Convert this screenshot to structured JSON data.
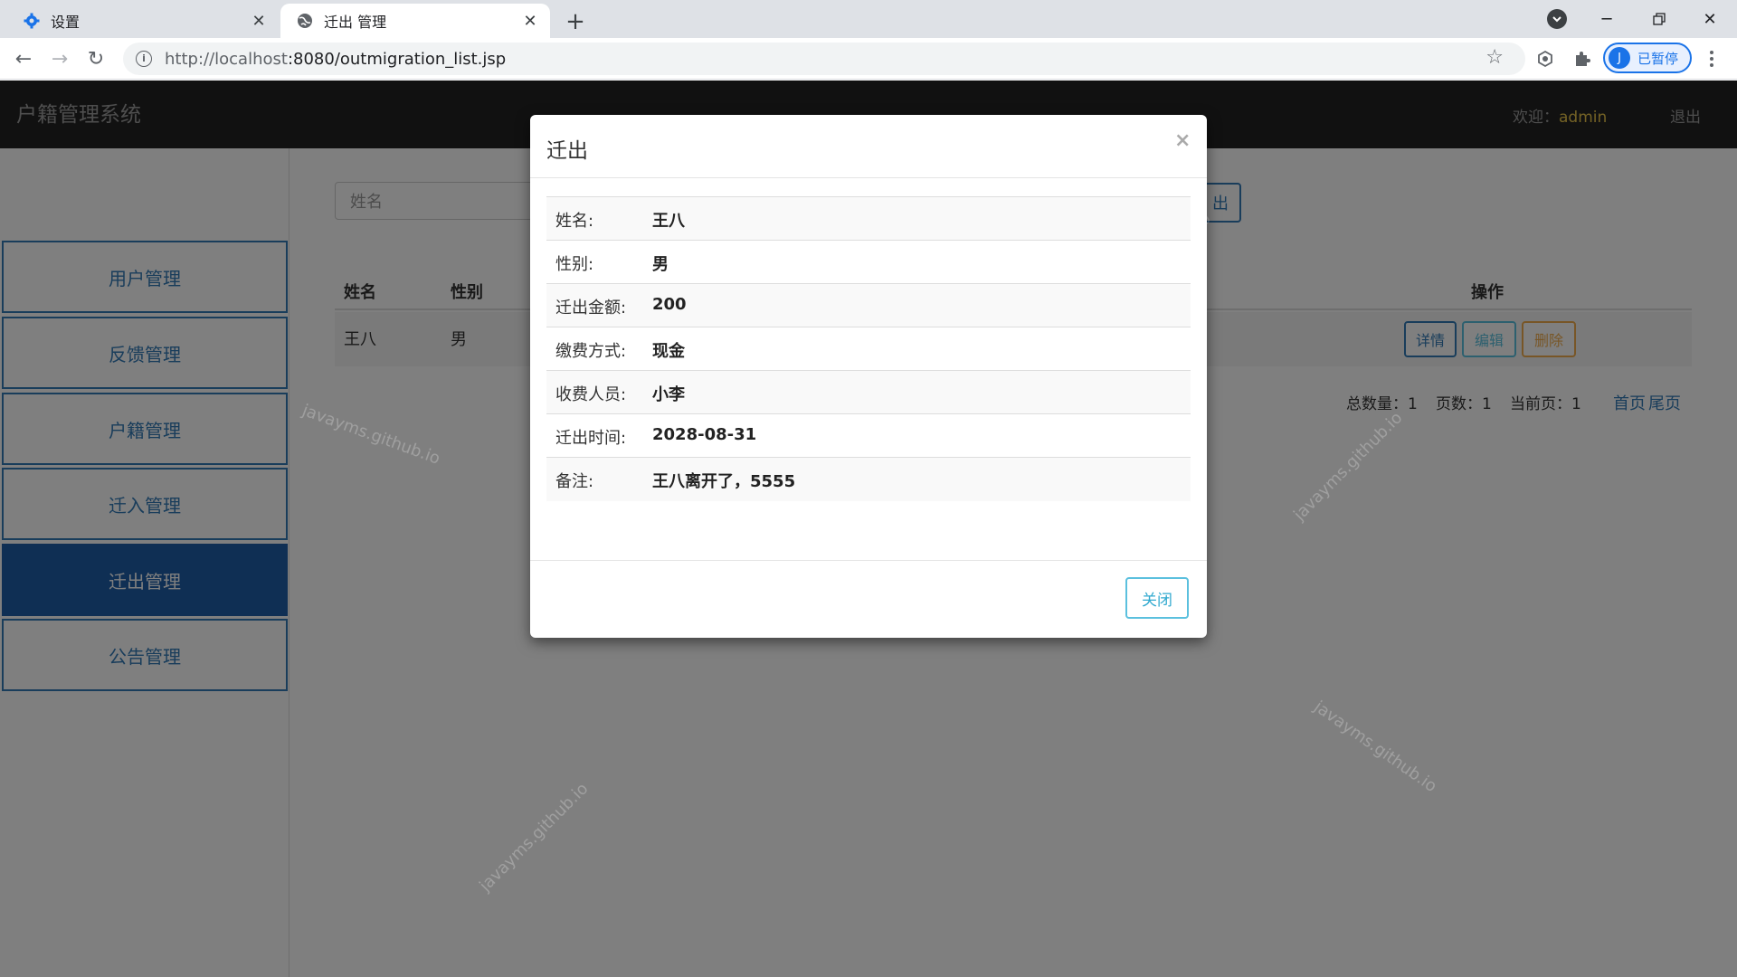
{
  "browser": {
    "tabs": [
      {
        "title": "设置",
        "icon": "gear-icon",
        "active": false
      },
      {
        "title": "迁出 管理",
        "icon": "globe-icon",
        "active": true
      }
    ],
    "url_host": "http://localhost",
    "url_rest": ":8080/outmigration_list.jsp",
    "profile_initial": "J",
    "profile_status": "已暂停"
  },
  "app": {
    "title": "户籍管理系统",
    "welcome_label": "欢迎：",
    "username": "admin",
    "logout": "退出"
  },
  "sidebar": {
    "items": [
      {
        "label": "用户管理",
        "active": false
      },
      {
        "label": "反馈管理",
        "active": false
      },
      {
        "label": "户籍管理",
        "active": false
      },
      {
        "label": "迁入管理",
        "active": false
      },
      {
        "label": "迁出管理",
        "active": true
      },
      {
        "label": "公告管理",
        "active": false
      }
    ]
  },
  "search": {
    "placeholder": "姓名",
    "export_label": "出"
  },
  "table": {
    "headers": {
      "name": "姓名",
      "gender": "性别",
      "actions": "操作"
    },
    "rows": [
      {
        "name": "王八",
        "gender": "男",
        "btn_detail": "详情",
        "btn_edit": "编辑",
        "btn_delete": "删除"
      }
    ]
  },
  "pager": {
    "total": "总数量：1",
    "pages": "页数：1",
    "current": "当前页：1",
    "first": "首页",
    "last": "尾页"
  },
  "modal": {
    "title": "迁出",
    "close_icon": "×",
    "fields": [
      {
        "key": "姓名:",
        "value": "王八"
      },
      {
        "key": "性别:",
        "value": "男"
      },
      {
        "key": "迁出金额:",
        "value": "200"
      },
      {
        "key": "缴费方式:",
        "value": "现金"
      },
      {
        "key": "收费人员:",
        "value": "小李"
      },
      {
        "key": "迁出时间:",
        "value": "2028-08-31"
      },
      {
        "key": "备注:",
        "value": "王八离开了，5555"
      }
    ],
    "close_label": "关闭"
  },
  "watermark": "javayms.github.io"
}
